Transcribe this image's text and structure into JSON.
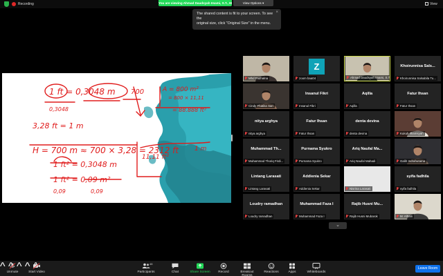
{
  "topbar": {
    "recording_label": "Recording",
    "viewing_text": "You are viewing Ahmad Daudsyah Imami, S.T., M...'s screen",
    "view_options_label": "View Options",
    "view_label": "View"
  },
  "notice": {
    "line1": "The shared content is fit to your screen. To see the",
    "line2": "original size, click \"Original Size\" in the menu.",
    "close_glyph": "×"
  },
  "whiteboard": {
    "lines": [
      "1 ft = 0,3048 m",
      "0,3048",
      "3,28 ft = 1 m",
      "H = 700 m ≈ 700 × 3,28 = 2312 ft",
      "1 ft² = 0,3048 m",
      "1 ft² = 0,09 m²",
      "0,09",
      "0,09"
    ],
    "extra_labels": [
      "700",
      "A = 800 m²",
      "= 800 × 11,11",
      "= 88.888 ft²",
      "11,11 ft²",
      "1 m"
    ]
  },
  "gallery": {
    "tiles": [
      {
        "name": "",
        "label": "Mhd Fadhalna",
        "kind": "video-a"
      },
      {
        "name": "",
        "label": "zoom baa04",
        "kind": "avatar",
        "avatar_letter": "Z"
      },
      {
        "name": "",
        "label": "Ahmad Daudsyah Imami, S.T.,...",
        "kind": "video-b",
        "active": true
      },
      {
        "name": "Khoirunnisa Sals...",
        "label": "Khoirunnisa Salsabila Tu...",
        "kind": "name"
      },
      {
        "name": "",
        "label": "Cindy Fhatika Sari",
        "kind": "video-c"
      },
      {
        "name": "Insanul Fikri",
        "label": "Insanul Fikri",
        "kind": "name"
      },
      {
        "name": "Aqilla",
        "label": "Aqilla",
        "kind": "name"
      },
      {
        "name": "Fatur Ihsan",
        "label": "Fatur Ihsan",
        "kind": "name"
      },
      {
        "name": "nitya arghya",
        "label": "nitya arghya",
        "kind": "name"
      },
      {
        "name": "Fatur Ihsan",
        "label": "Fatur Ihsan",
        "kind": "name"
      },
      {
        "name": "denta devina",
        "label": "denta devina",
        "kind": "name"
      },
      {
        "name": "",
        "label": "Kukuh Ilhamsyah",
        "kind": "video-d"
      },
      {
        "name": "Muhammad Th...",
        "label": "Muhammad Thoriq Firdi...",
        "kind": "name"
      },
      {
        "name": "Purnama Syukro",
        "label": "Purnama Syukro",
        "kind": "name"
      },
      {
        "name": "Ariq Naufal Ma...",
        "label": "Ariq Naufal Mahadi",
        "kind": "name"
      },
      {
        "name": "",
        "label": "Galih Indrahutama",
        "kind": "video-e"
      },
      {
        "name": "Lintang Larasati",
        "label": "Lintang Larasati",
        "kind": "name"
      },
      {
        "name": "Addienia Sekar",
        "label": "Addienia Sekar",
        "kind": "name"
      },
      {
        "name": "",
        "label": "Nisrina Larasati",
        "kind": "video-f"
      },
      {
        "name": "syifa fadhila",
        "label": "syifa fadhila",
        "kind": "name"
      },
      {
        "name": "Loudry ramadhan",
        "label": "Loudry ramadhan",
        "kind": "name"
      },
      {
        "name": "Muhammad Faza I",
        "label": "Muhammad Faza I",
        "kind": "name"
      },
      {
        "name": "Rajib Husni Mu...",
        "label": "Rajib Husni Mubarok",
        "kind": "name"
      },
      {
        "name": "",
        "label": "M. Alham",
        "kind": "video-g"
      }
    ],
    "next_glyph": "⌄"
  },
  "toolbar": {
    "unmute": "Unmute",
    "start_video": "Start Video",
    "participants": "Participants",
    "participants_count": "48",
    "chat": "Chat",
    "share_screen": "Share Screen",
    "record": "Record",
    "breakout_rooms": "Breakout Rooms",
    "reactions": "Reactions",
    "apps": "Apps",
    "whiteboards": "Whiteboards",
    "leave": "Leave Room"
  },
  "colors": {
    "share_green": "#23d959",
    "leave_blue": "#0e71eb",
    "ink_red": "#e01b1b",
    "teal_splash": "#1f9aa8"
  }
}
